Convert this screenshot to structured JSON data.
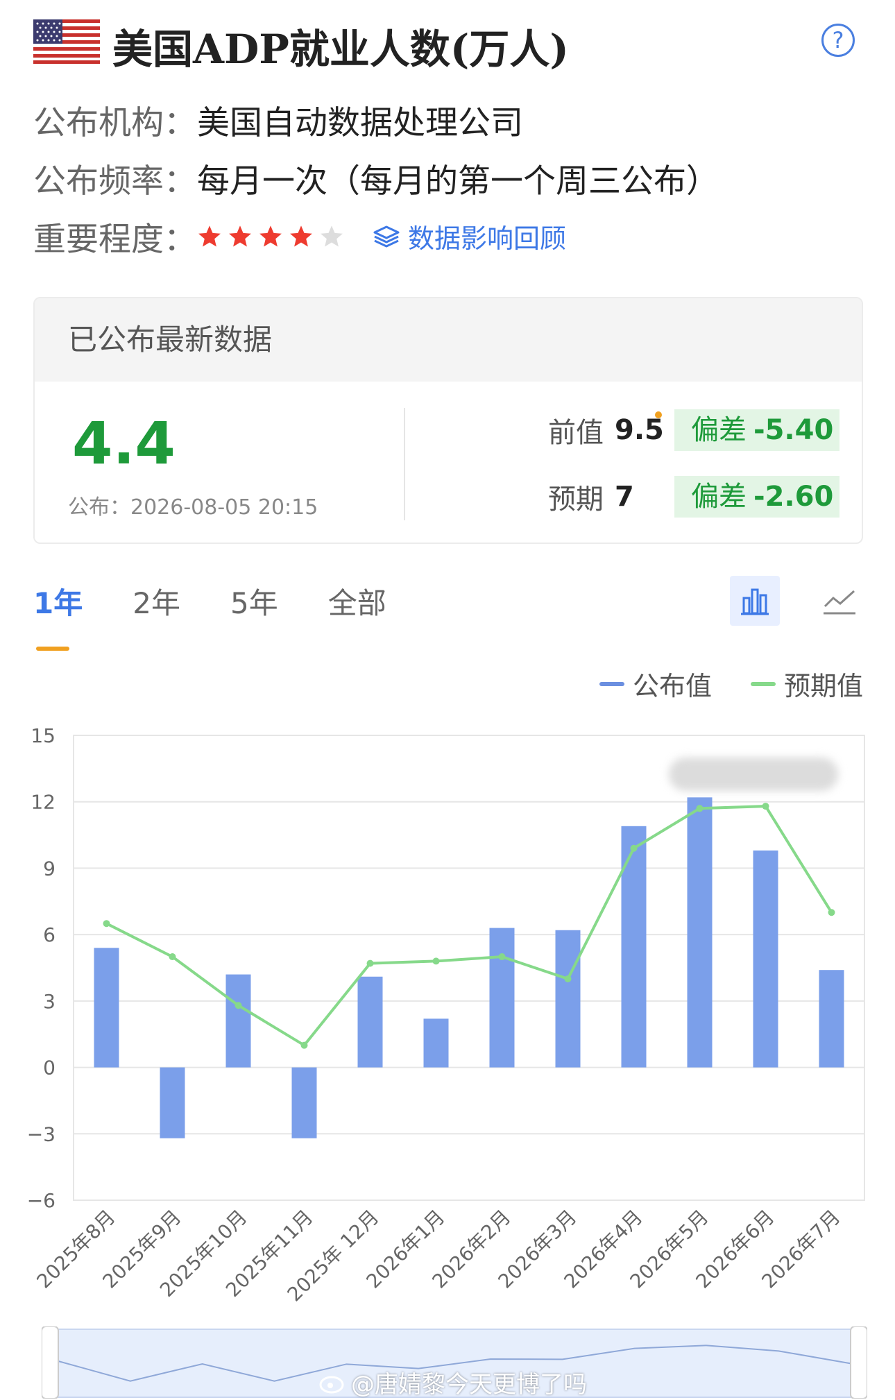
{
  "header": {
    "title": "美国ADP就业人数(万人)",
    "flag_icon": "us-flag-icon",
    "help_label": "?"
  },
  "info": {
    "publisher_label": "公布机构：",
    "publisher_value": "美国自动数据处理公司",
    "frequency_label": "公布频率：",
    "frequency_value": "每月一次（每月的第一个周三公布）",
    "importance_label": "重要程度：",
    "importance_stars": 4,
    "importance_max": 5,
    "review_link": "数据影响回顾"
  },
  "latest": {
    "heading": "已公布最新数据",
    "value": "4.4",
    "published": "公布：2026-08-05 20:15",
    "prev_label": "前值",
    "prev_value": "9.5",
    "prev_dev_label": "偏差",
    "prev_dev": "-5.40",
    "forecast_label": "预期",
    "forecast_value": "7",
    "forecast_dev_label": "偏差",
    "forecast_dev": "-2.60"
  },
  "tabs": [
    "1年",
    "2年",
    "5年",
    "全部"
  ],
  "active_tab": 0,
  "legend": {
    "actual": "公布值",
    "expected": "预期值"
  },
  "colors": {
    "bar": "#7b9fea",
    "line": "#86d98a",
    "accent": "#3d78e6",
    "positive": "#1e9a3a",
    "star_on": "#ee3b2f",
    "star_off": "#dddddd"
  },
  "watermark": "@唐婧黎今天更博了吗",
  "chart_data": {
    "type": "bar",
    "categories": [
      "2025年8月",
      "2025年9月",
      "2025年10月",
      "2025年11月",
      "2025年 12月",
      "2026年1月",
      "2026年2月",
      "2026年3月",
      "2026年4月",
      "2026年5月",
      "2026年6月",
      "2026年7月"
    ],
    "series": [
      {
        "name": "公布值",
        "type": "bar",
        "values": [
          5.4,
          -3.2,
          4.2,
          -3.2,
          4.1,
          2.2,
          6.3,
          6.2,
          10.9,
          12.2,
          9.8,
          4.4
        ]
      },
      {
        "name": "预期值",
        "type": "line",
        "values": [
          6.5,
          5.0,
          2.8,
          1.0,
          4.7,
          4.8,
          5.0,
          4.0,
          9.9,
          11.7,
          11.8,
          7.0
        ]
      }
    ],
    "yticks": [
      15,
      12,
      9,
      6,
      3,
      0,
      -3,
      -6
    ],
    "ylim": [
      -6,
      15
    ],
    "grid": true,
    "legend_position": "top-right"
  }
}
